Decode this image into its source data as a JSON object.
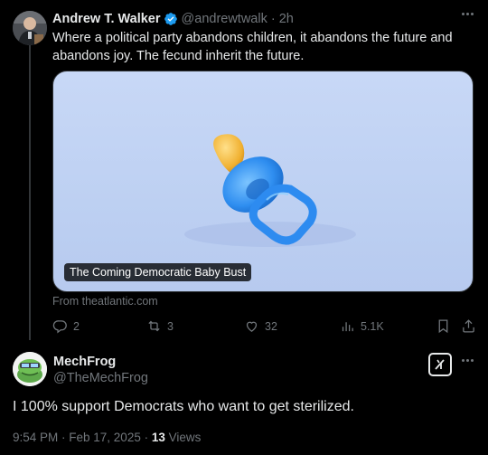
{
  "parent_tweet": {
    "author_name": "Andrew T. Walker",
    "handle": "@andrewtwalk",
    "separator": "·",
    "time": "2h",
    "text": "Where a political party abandons children, it abandons the future and abandons joy. The fecund inherit the future.",
    "card": {
      "caption": "The Coming Democratic Baby Bust",
      "source": "From theatlantic.com"
    },
    "actions": {
      "replies": "2",
      "reposts": "3",
      "likes": "32",
      "views": "5.1K"
    },
    "icons": [
      "verified-badge-icon",
      "more-icon",
      "reply-icon",
      "repost-icon",
      "like-icon",
      "views-icon",
      "bookmark-icon",
      "share-icon"
    ]
  },
  "main_tweet": {
    "author_name": "MechFrog",
    "handle": "@TheMechFrog",
    "text": "I 100% support Democrats who want to get sterilized.",
    "timestamp": "9:54 PM · Feb 17, 2025 · ",
    "views_count": "13",
    "views_label": " Views",
    "icons": [
      "grok-icon",
      "more-icon"
    ]
  },
  "colors": {
    "background": "#000000",
    "text": "#e7e9ea",
    "muted": "#71767b",
    "verified": "#1d9bf0"
  }
}
